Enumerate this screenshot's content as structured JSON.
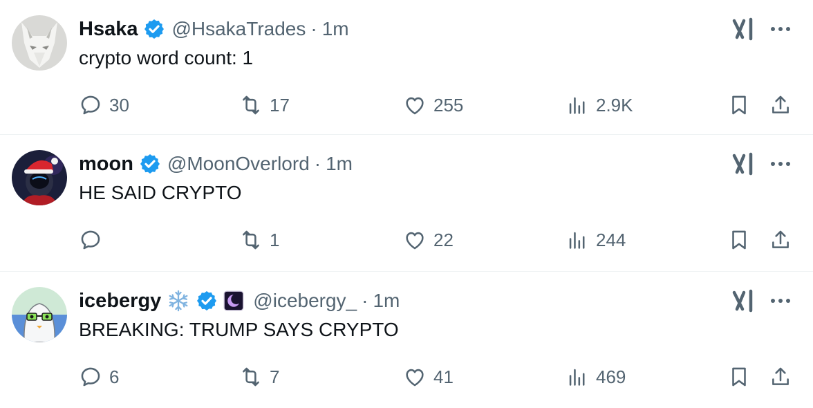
{
  "tweets": [
    {
      "name": "Hsaka",
      "handle": "@HsakaTrades",
      "separator": "·",
      "time": "1m",
      "text": "crypto word count: 1",
      "replies": "30",
      "reposts": "17",
      "likes": "255",
      "views": "2.9K",
      "avatar": "white-wolf-avatar"
    },
    {
      "name": "moon",
      "handle": "@MoonOverlord",
      "separator": "·",
      "time": "1m",
      "text": "HE SAID CRYPTO",
      "replies": "",
      "reposts": "1",
      "likes": "22",
      "views": "244",
      "avatar": "santa-astronaut-avatar"
    },
    {
      "name": "icebergy",
      "handle": "@icebergy_",
      "separator": "·",
      "time": "1m",
      "text": "BREAKING: TRUMP SAYS CRYPTO",
      "replies": "6",
      "reposts": "7",
      "likes": "41",
      "views": "469",
      "avatar": "penguin-glasses-avatar",
      "name_emoji": "snowflake-icon",
      "affiliate_badge": "moon-badge-icon"
    }
  ],
  "colors": {
    "text": "#0f1419",
    "secondary": "#536471",
    "verified": "#1d9bf0",
    "divider": "#eff3f4"
  }
}
